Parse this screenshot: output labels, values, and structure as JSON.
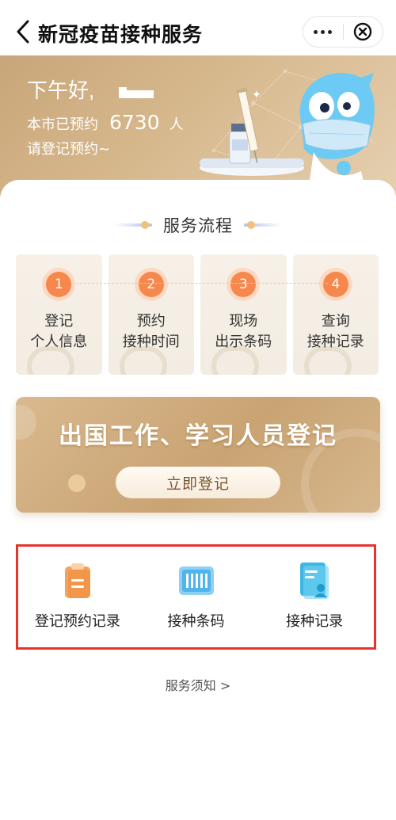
{
  "header": {
    "title": "新冠疫苗接种服务",
    "back_icon": "chevron-left-icon",
    "more_icon": "more-dots-icon",
    "close_icon": "circle-close-icon"
  },
  "banner": {
    "greeting": "下午好,",
    "stats_prefix": "本市已预约",
    "stats_count": "6730",
    "stats_unit": "人",
    "prompt": "请登记预约~"
  },
  "process": {
    "title": "服务流程",
    "steps": [
      {
        "num": "1",
        "line1": "登记",
        "line2": "个人信息"
      },
      {
        "num": "2",
        "line1": "预约",
        "line2": "接种时间"
      },
      {
        "num": "3",
        "line1": "现场",
        "line2": "出示条码"
      },
      {
        "num": "4",
        "line1": "查询",
        "line2": "接种记录"
      }
    ]
  },
  "promo": {
    "title": "出国工作、学习人员登记",
    "button": "立即登记"
  },
  "quick_links": [
    {
      "label": "登记预约记录",
      "icon": "clipboard-icon"
    },
    {
      "label": "接种条码",
      "icon": "barcode-icon"
    },
    {
      "label": "接种记录",
      "icon": "vaccination-record-icon"
    }
  ],
  "footer": {
    "notice": "服务须知 >"
  },
  "colors": {
    "accent_orange": "#f6874d",
    "banner_gold": "#c8a679",
    "highlight_red": "#e5332d"
  }
}
